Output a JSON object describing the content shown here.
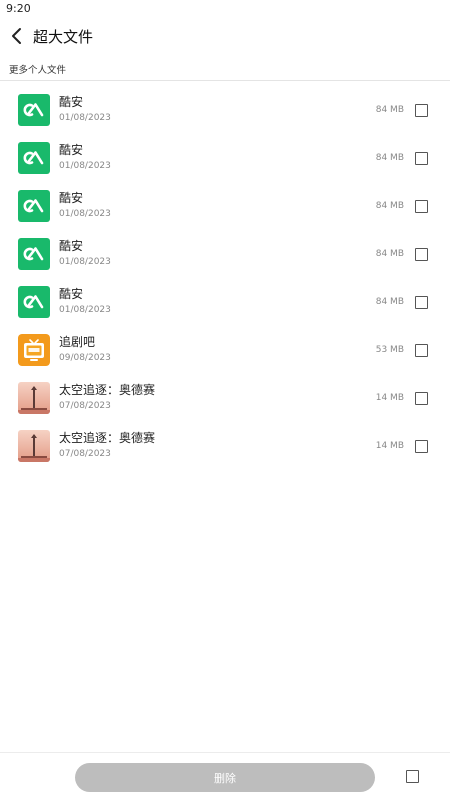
{
  "status_bar": {
    "time": "9:20"
  },
  "header": {
    "title": "超大文件",
    "back_icon": "chevron-left-icon"
  },
  "section": {
    "label": "更多个人文件"
  },
  "items": [
    {
      "name": "酷安",
      "date": "01/08/2023",
      "size": "84 MB",
      "icon": "coolapk-icon"
    },
    {
      "name": "酷安",
      "date": "01/08/2023",
      "size": "84 MB",
      "icon": "coolapk-icon"
    },
    {
      "name": "酷安",
      "date": "01/08/2023",
      "size": "84 MB",
      "icon": "coolapk-icon"
    },
    {
      "name": "酷安",
      "date": "01/08/2023",
      "size": "84 MB",
      "icon": "coolapk-icon"
    },
    {
      "name": "酷安",
      "date": "01/08/2023",
      "size": "84 MB",
      "icon": "coolapk-icon"
    },
    {
      "name": "追剧吧",
      "date": "09/08/2023",
      "size": "53 MB",
      "icon": "tv-icon"
    },
    {
      "name": "太空追逐：奥德赛",
      "date": "07/08/2023",
      "size": "14 MB",
      "icon": "rocket-game-icon"
    },
    {
      "name": "太空追逐：奥德赛",
      "date": "07/08/2023",
      "size": "14 MB",
      "icon": "rocket-game-icon"
    }
  ],
  "footer": {
    "delete_label": "删除"
  },
  "colors": {
    "coolapk_green": "#19b96b",
    "tv_orange": "#f39a1c",
    "delete_disabled": "#bdbdbd"
  }
}
